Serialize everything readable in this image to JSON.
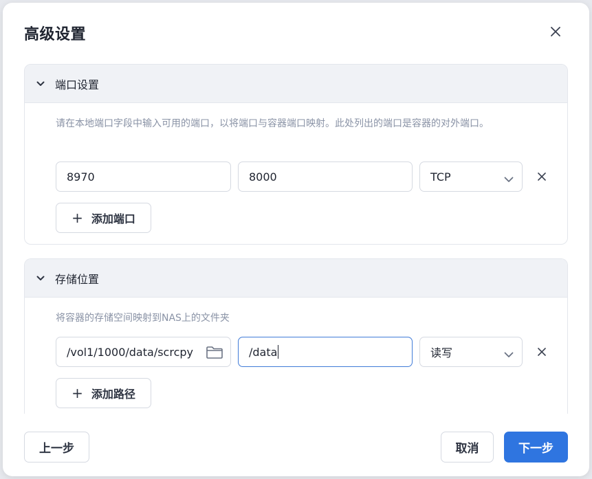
{
  "dialog": {
    "title": "高级设置",
    "close_icon": "close-icon"
  },
  "ports": {
    "title": "端口设置",
    "description": "请在本地端口字段中输入可用的端口，以将端口与容器端口映射。此处列出的端口是容器的对外端口。",
    "rows": [
      {
        "local_port": "8970",
        "container_port": "8000",
        "protocol": "TCP"
      }
    ],
    "add_label": "添加端口"
  },
  "storage": {
    "title": "存储位置",
    "description": "将容器的存储空间映射到NAS上的文件夹",
    "rows": [
      {
        "nas_path": "/vol1/1000/data/scrcpy",
        "container_path": "/data",
        "permission": "读写"
      }
    ],
    "add_label": "添加路径"
  },
  "footer": {
    "prev_label": "上一步",
    "cancel_label": "取消",
    "next_label": "下一步"
  },
  "colors": {
    "accent": "#2f75e0",
    "focus_border": "#3f7bd8",
    "header_bg": "#f0f2f6",
    "muted_text": "#8a93a6"
  }
}
